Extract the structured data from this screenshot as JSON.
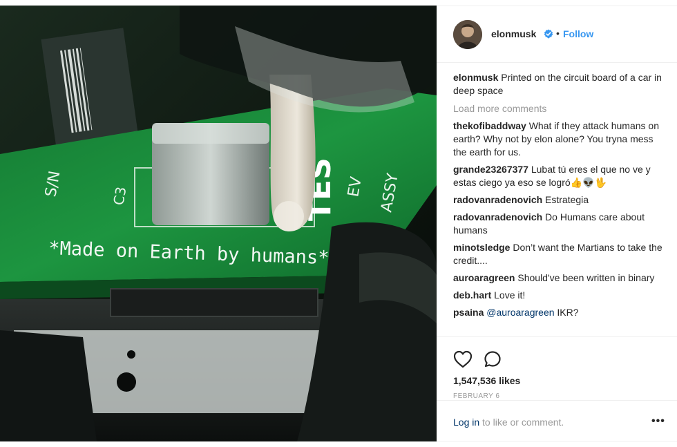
{
  "post": {
    "username": "elonmusk",
    "follow_label": "Follow",
    "separator": "•",
    "caption_user": "elonmusk",
    "caption_text": "Printed on the circuit board of a car in deep space",
    "load_more": "Load more comments",
    "likes": "1,547,536 likes",
    "date": "FEBRUARY 6",
    "login_link": "Log in",
    "login_rest": " to like or comment.",
    "more_label": "•••"
  },
  "image": {
    "board_text": "*Made on Earth by humans*",
    "silk_sn": "S/N",
    "silk_c3": "C3",
    "silk_ev": "EV",
    "silk_assy": "ASSY",
    "silk_tes": "TES"
  },
  "comments": [
    {
      "user": "thekofibaddway",
      "text": "What if they attack humans on earth? Why not by elon alone? You tryna mess the earth for us."
    },
    {
      "user": "grande23267377",
      "text": "Lubat tú eres el que no ve y estas ciego ya eso se logró👍👽🖖"
    },
    {
      "user": "radovanradenovich",
      "text": "Estrategia"
    },
    {
      "user": "radovanradenovich",
      "text": "Do Humans care about humans"
    },
    {
      "user": "minotsledge",
      "text": "Don’t want the Martians to take the credit...."
    },
    {
      "user": "auroaragreen",
      "text": "Should've been written in binary"
    },
    {
      "user": "deb.hart",
      "text": "Love it!"
    },
    {
      "user": "psaina",
      "mention": "@auroaragreen",
      "text": " IKR?"
    }
  ],
  "colors": {
    "accent": "#3897f0",
    "link": "#003569",
    "muted": "#999999",
    "board_green": "#1f8a3c"
  },
  "icons": {
    "verified": "verified-badge-icon",
    "like": "heart-icon",
    "comment": "comment-bubble-icon"
  }
}
